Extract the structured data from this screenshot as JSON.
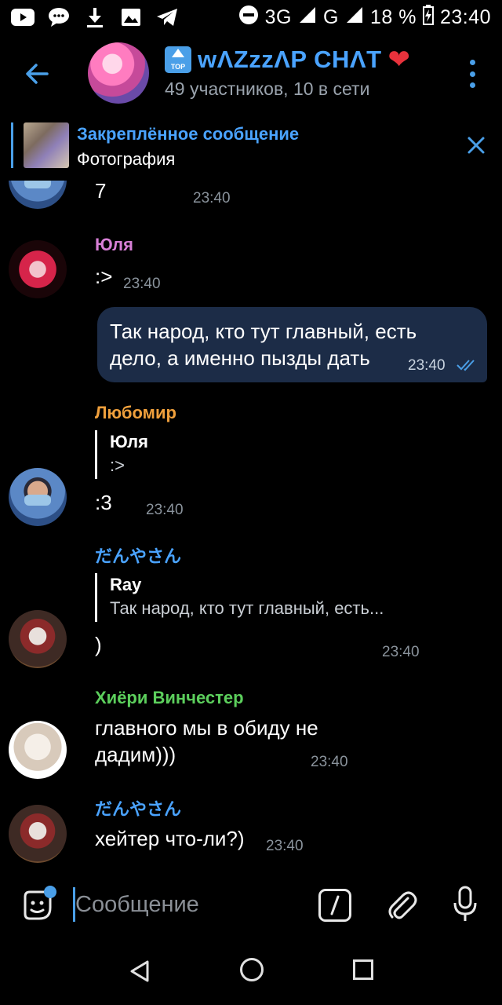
{
  "status_bar": {
    "network": "3G",
    "network_super": "3G",
    "carrier2": "G",
    "battery": "18 %",
    "time": "23:40"
  },
  "header": {
    "title": "wΛZzzΛP CHΛT",
    "badge": "TOP",
    "subtitle": "49 участников, 10 в сети",
    "accent": "#4aa3ff"
  },
  "pinned": {
    "title": "Закреплённое сообщение",
    "subtitle": "Фотография"
  },
  "messages": [
    {
      "text": "7",
      "time": "23:40"
    },
    {
      "sender": "Юля",
      "sender_color": "#d77fd6",
      "text": ":>",
      "time": "23:40"
    },
    {
      "outgoing": true,
      "text": "Так народ, кто тут главный, есть дело, а именно пызды дать",
      "time": "23:40"
    },
    {
      "sender": "Любомир",
      "sender_color": "#f0a03c",
      "reply_name": "Юля",
      "reply_text": ":>",
      "text": ":3",
      "time": "23:40"
    },
    {
      "sender": "だんやさん",
      "sender_color": "#4aa3ff",
      "reply_name": "Ray",
      "reply_text": "Так народ, кто тут главный, есть...",
      "text": ")",
      "time": "23:40"
    },
    {
      "sender": "Хиёри Винчестер",
      "sender_color": "#5ccf5c",
      "text": "главного мы в обиду не дадим)))",
      "time": "23:40"
    },
    {
      "sender": "だんやさん",
      "sender_color": "#4aa3ff",
      "text": "хейтер что-ли?)",
      "time": "23:40"
    }
  ],
  "composer": {
    "placeholder": "Сообщение",
    "cmd_label": "/"
  }
}
